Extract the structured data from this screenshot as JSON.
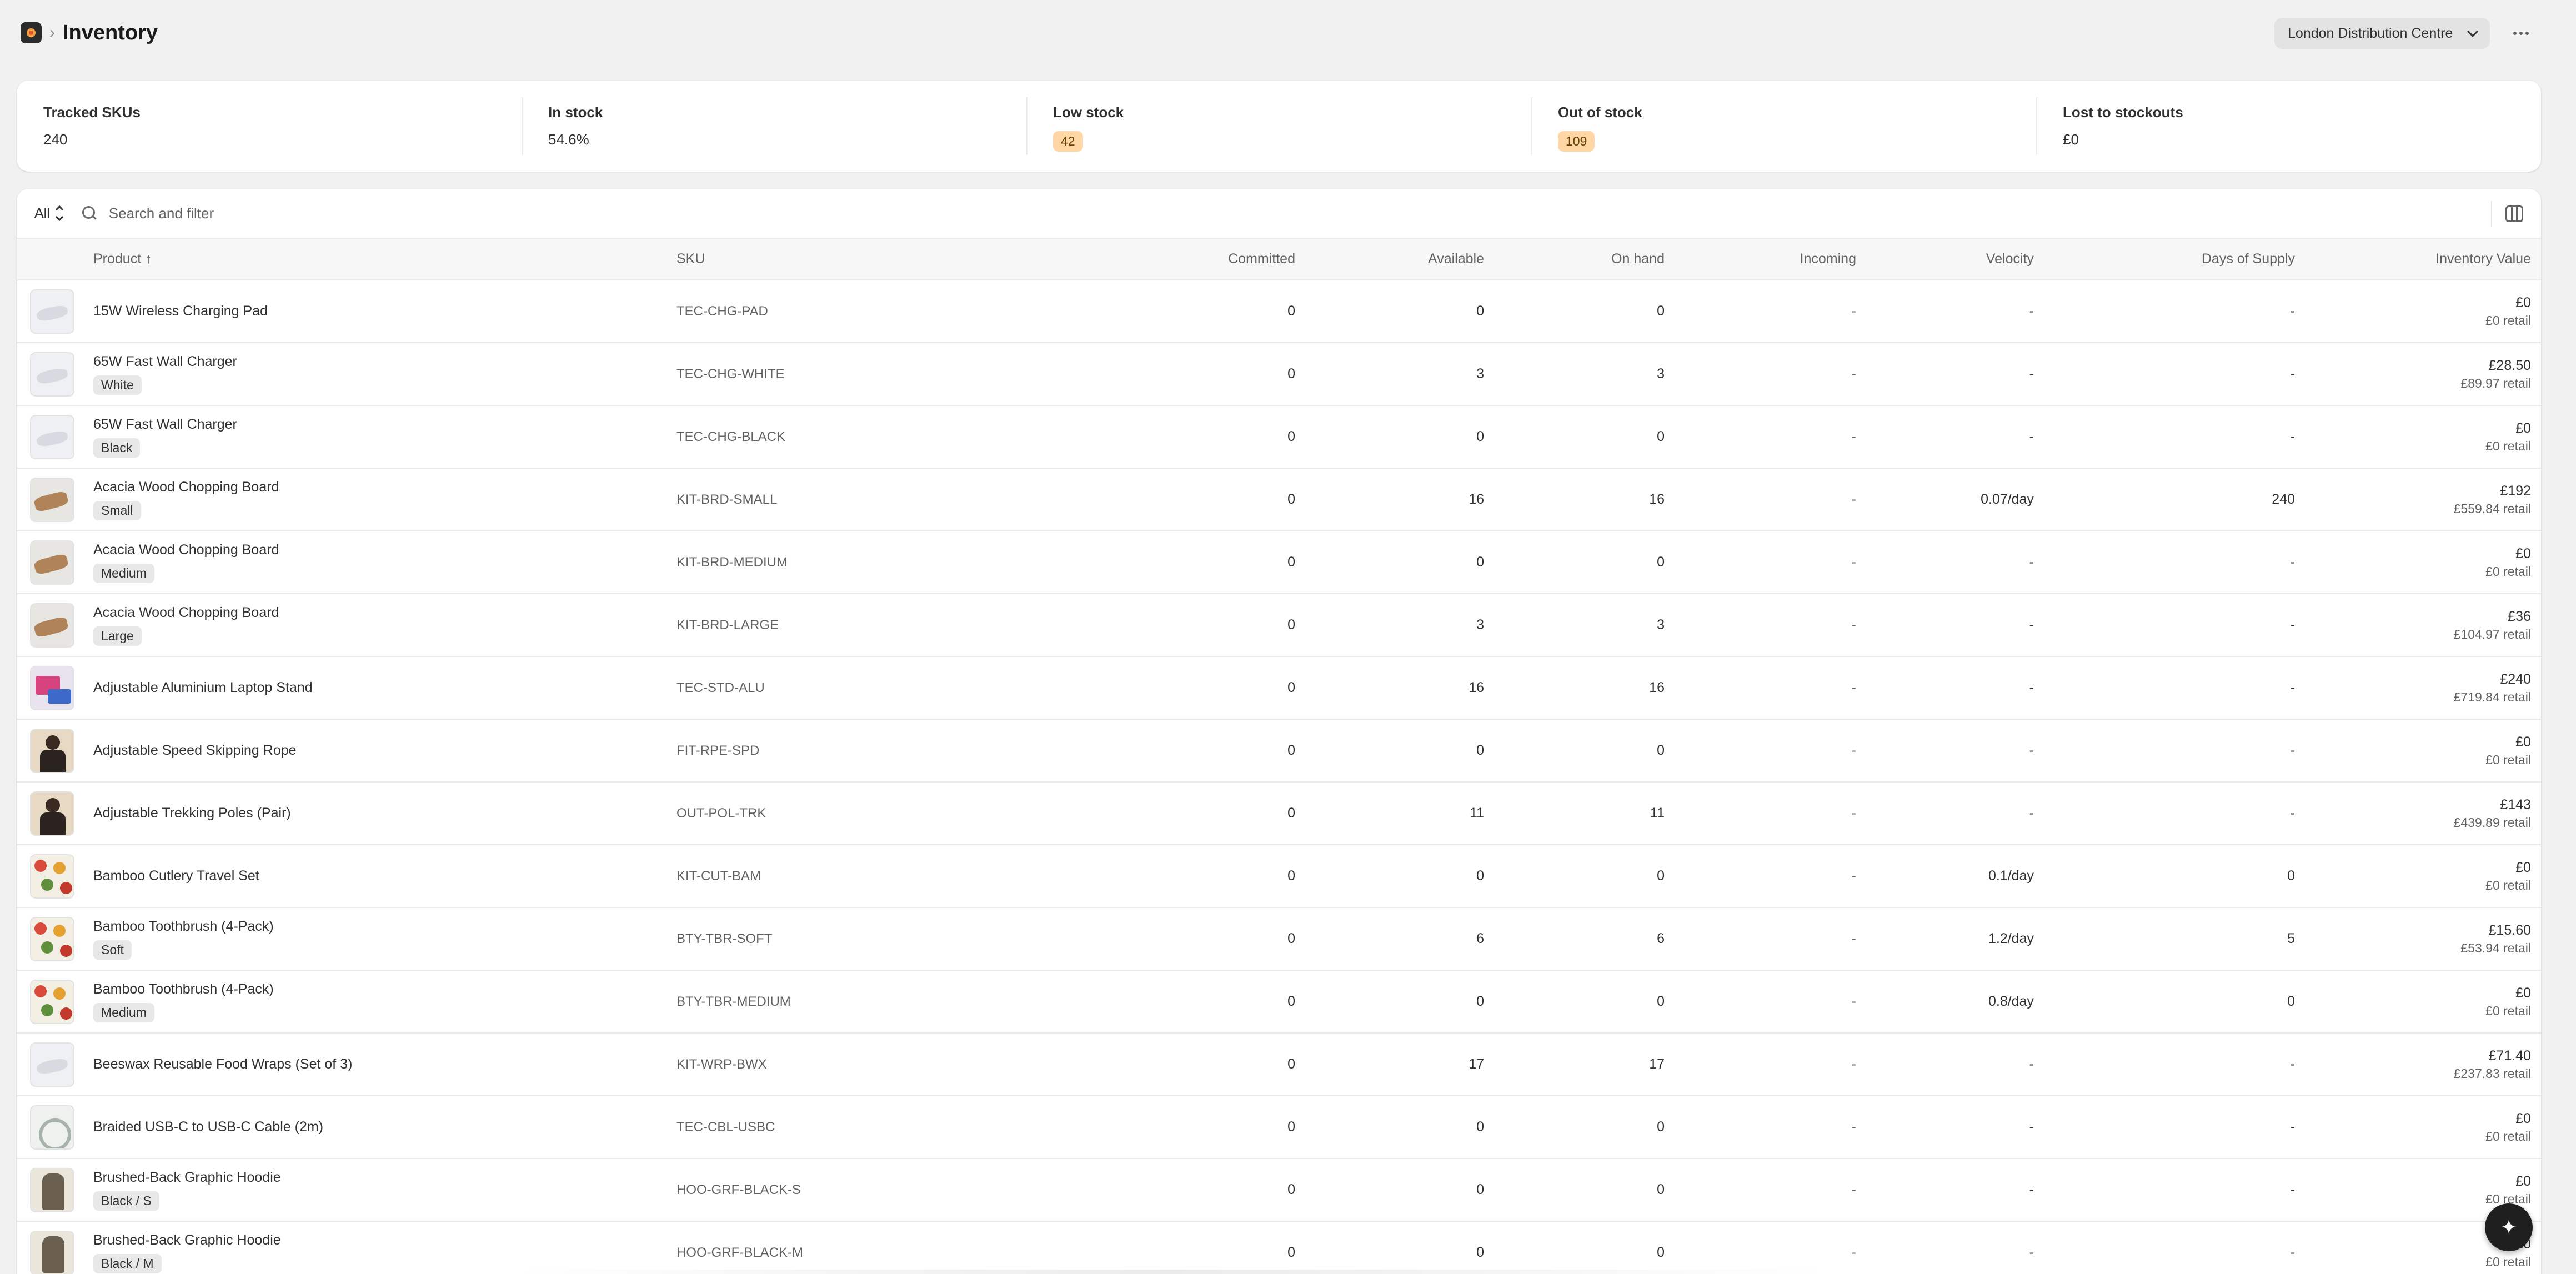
{
  "header": {
    "title": "Inventory",
    "location": "London Distribution Centre"
  },
  "metrics": [
    {
      "label": "Tracked SKUs",
      "value": "240",
      "badge": false
    },
    {
      "label": "In stock",
      "value": "54.6%",
      "badge": false
    },
    {
      "label": "Low stock",
      "value": "42",
      "badge": true
    },
    {
      "label": "Out of stock",
      "value": "109",
      "badge": true
    },
    {
      "label": "Lost to stockouts",
      "value": "£0",
      "badge": false
    }
  ],
  "filter": {
    "tab": "All",
    "search_placeholder": "Search and filter"
  },
  "columns": {
    "product": "Product ↑",
    "sku": "SKU",
    "committed": "Committed",
    "available": "Available",
    "on_hand": "On hand",
    "incoming": "Incoming",
    "velocity": "Velocity",
    "days_of_supply": "Days of Supply",
    "inventory_value": "Inventory Value"
  },
  "rows": [
    {
      "name": "15W Wireless Charging Pad",
      "variant": "",
      "thumb": "t-white",
      "sku": "TEC-CHG-PAD",
      "committed": "0",
      "available": "0",
      "on_hand": "0",
      "incoming": "-",
      "velocity": "-",
      "dos": "-",
      "value": "£0",
      "retail": "£0 retail"
    },
    {
      "name": "65W Fast Wall Charger",
      "variant": "White",
      "thumb": "t-white",
      "sku": "TEC-CHG-WHITE",
      "committed": "0",
      "available": "3",
      "on_hand": "3",
      "incoming": "-",
      "velocity": "-",
      "dos": "-",
      "value": "£28.50",
      "retail": "£89.97 retail"
    },
    {
      "name": "65W Fast Wall Charger",
      "variant": "Black",
      "thumb": "t-white",
      "sku": "TEC-CHG-BLACK",
      "committed": "0",
      "available": "0",
      "on_hand": "0",
      "incoming": "-",
      "velocity": "-",
      "dos": "-",
      "value": "£0",
      "retail": "£0 retail"
    },
    {
      "name": "Acacia Wood Chopping Board",
      "variant": "Small",
      "thumb": "t-wood",
      "sku": "KIT-BRD-SMALL",
      "committed": "0",
      "available": "16",
      "on_hand": "16",
      "incoming": "-",
      "velocity": "0.07/day",
      "dos": "240",
      "value": "£192",
      "retail": "£559.84 retail"
    },
    {
      "name": "Acacia Wood Chopping Board",
      "variant": "Medium",
      "thumb": "t-wood",
      "sku": "KIT-BRD-MEDIUM",
      "committed": "0",
      "available": "0",
      "on_hand": "0",
      "incoming": "-",
      "velocity": "-",
      "dos": "-",
      "value": "£0",
      "retail": "£0 retail"
    },
    {
      "name": "Acacia Wood Chopping Board",
      "variant": "Large",
      "thumb": "t-wood",
      "sku": "KIT-BRD-LARGE",
      "committed": "0",
      "available": "3",
      "on_hand": "3",
      "incoming": "-",
      "velocity": "-",
      "dos": "-",
      "value": "£36",
      "retail": "£104.97 retail"
    },
    {
      "name": "Adjustable Aluminium Laptop Stand",
      "variant": "",
      "thumb": "t-laptop",
      "sku": "TEC-STD-ALU",
      "committed": "0",
      "available": "16",
      "on_hand": "16",
      "incoming": "-",
      "velocity": "-",
      "dos": "-",
      "value": "£240",
      "retail": "£719.84 retail"
    },
    {
      "name": "Adjustable Speed Skipping Rope",
      "variant": "",
      "thumb": "t-person",
      "sku": "FIT-RPE-SPD",
      "committed": "0",
      "available": "0",
      "on_hand": "0",
      "incoming": "-",
      "velocity": "-",
      "dos": "-",
      "value": "£0",
      "retail": "£0 retail"
    },
    {
      "name": "Adjustable Trekking Poles (Pair)",
      "variant": "",
      "thumb": "t-person",
      "sku": "OUT-POL-TRK",
      "committed": "0",
      "available": "11",
      "on_hand": "11",
      "incoming": "-",
      "velocity": "-",
      "dos": "-",
      "value": "£143",
      "retail": "£439.89 retail"
    },
    {
      "name": "Bamboo Cutlery Travel Set",
      "variant": "",
      "thumb": "t-fruit",
      "sku": "KIT-CUT-BAM",
      "committed": "0",
      "available": "0",
      "on_hand": "0",
      "incoming": "-",
      "velocity": "0.1/day",
      "dos": "0",
      "value": "£0",
      "retail": "£0 retail"
    },
    {
      "name": "Bamboo Toothbrush (4-Pack)",
      "variant": "Soft",
      "thumb": "t-fruit",
      "sku": "BTY-TBR-SOFT",
      "committed": "0",
      "available": "6",
      "on_hand": "6",
      "incoming": "-",
      "velocity": "1.2/day",
      "dos": "5",
      "value": "£15.60",
      "retail": "£53.94 retail"
    },
    {
      "name": "Bamboo Toothbrush (4-Pack)",
      "variant": "Medium",
      "thumb": "t-fruit",
      "sku": "BTY-TBR-MEDIUM",
      "committed": "0",
      "available": "0",
      "on_hand": "0",
      "incoming": "-",
      "velocity": "0.8/day",
      "dos": "0",
      "value": "£0",
      "retail": "£0 retail"
    },
    {
      "name": "Beeswax Reusable Food Wraps (Set of 3)",
      "variant": "",
      "thumb": "t-white",
      "sku": "KIT-WRP-BWX",
      "committed": "0",
      "available": "17",
      "on_hand": "17",
      "incoming": "-",
      "velocity": "-",
      "dos": "-",
      "value": "£71.40",
      "retail": "£237.83 retail"
    },
    {
      "name": "Braided USB-C to USB-C Cable (2m)",
      "variant": "",
      "thumb": "t-cable",
      "sku": "TEC-CBL-USBC",
      "committed": "0",
      "available": "0",
      "on_hand": "0",
      "incoming": "-",
      "velocity": "-",
      "dos": "-",
      "value": "£0",
      "retail": "£0 retail"
    },
    {
      "name": "Brushed-Back Graphic Hoodie",
      "variant": "Black / S",
      "thumb": "t-hoodie",
      "sku": "HOO-GRF-BLACK-S",
      "committed": "0",
      "available": "0",
      "on_hand": "0",
      "incoming": "-",
      "velocity": "-",
      "dos": "-",
      "value": "£0",
      "retail": "£0 retail"
    },
    {
      "name": "Brushed-Back Graphic Hoodie",
      "variant": "Black / M",
      "thumb": "t-hoodie",
      "sku": "HOO-GRF-BLACK-M",
      "committed": "0",
      "available": "0",
      "on_hand": "0",
      "incoming": "-",
      "velocity": "-",
      "dos": "-",
      "value": "£0",
      "retail": "£0 retail"
    }
  ]
}
